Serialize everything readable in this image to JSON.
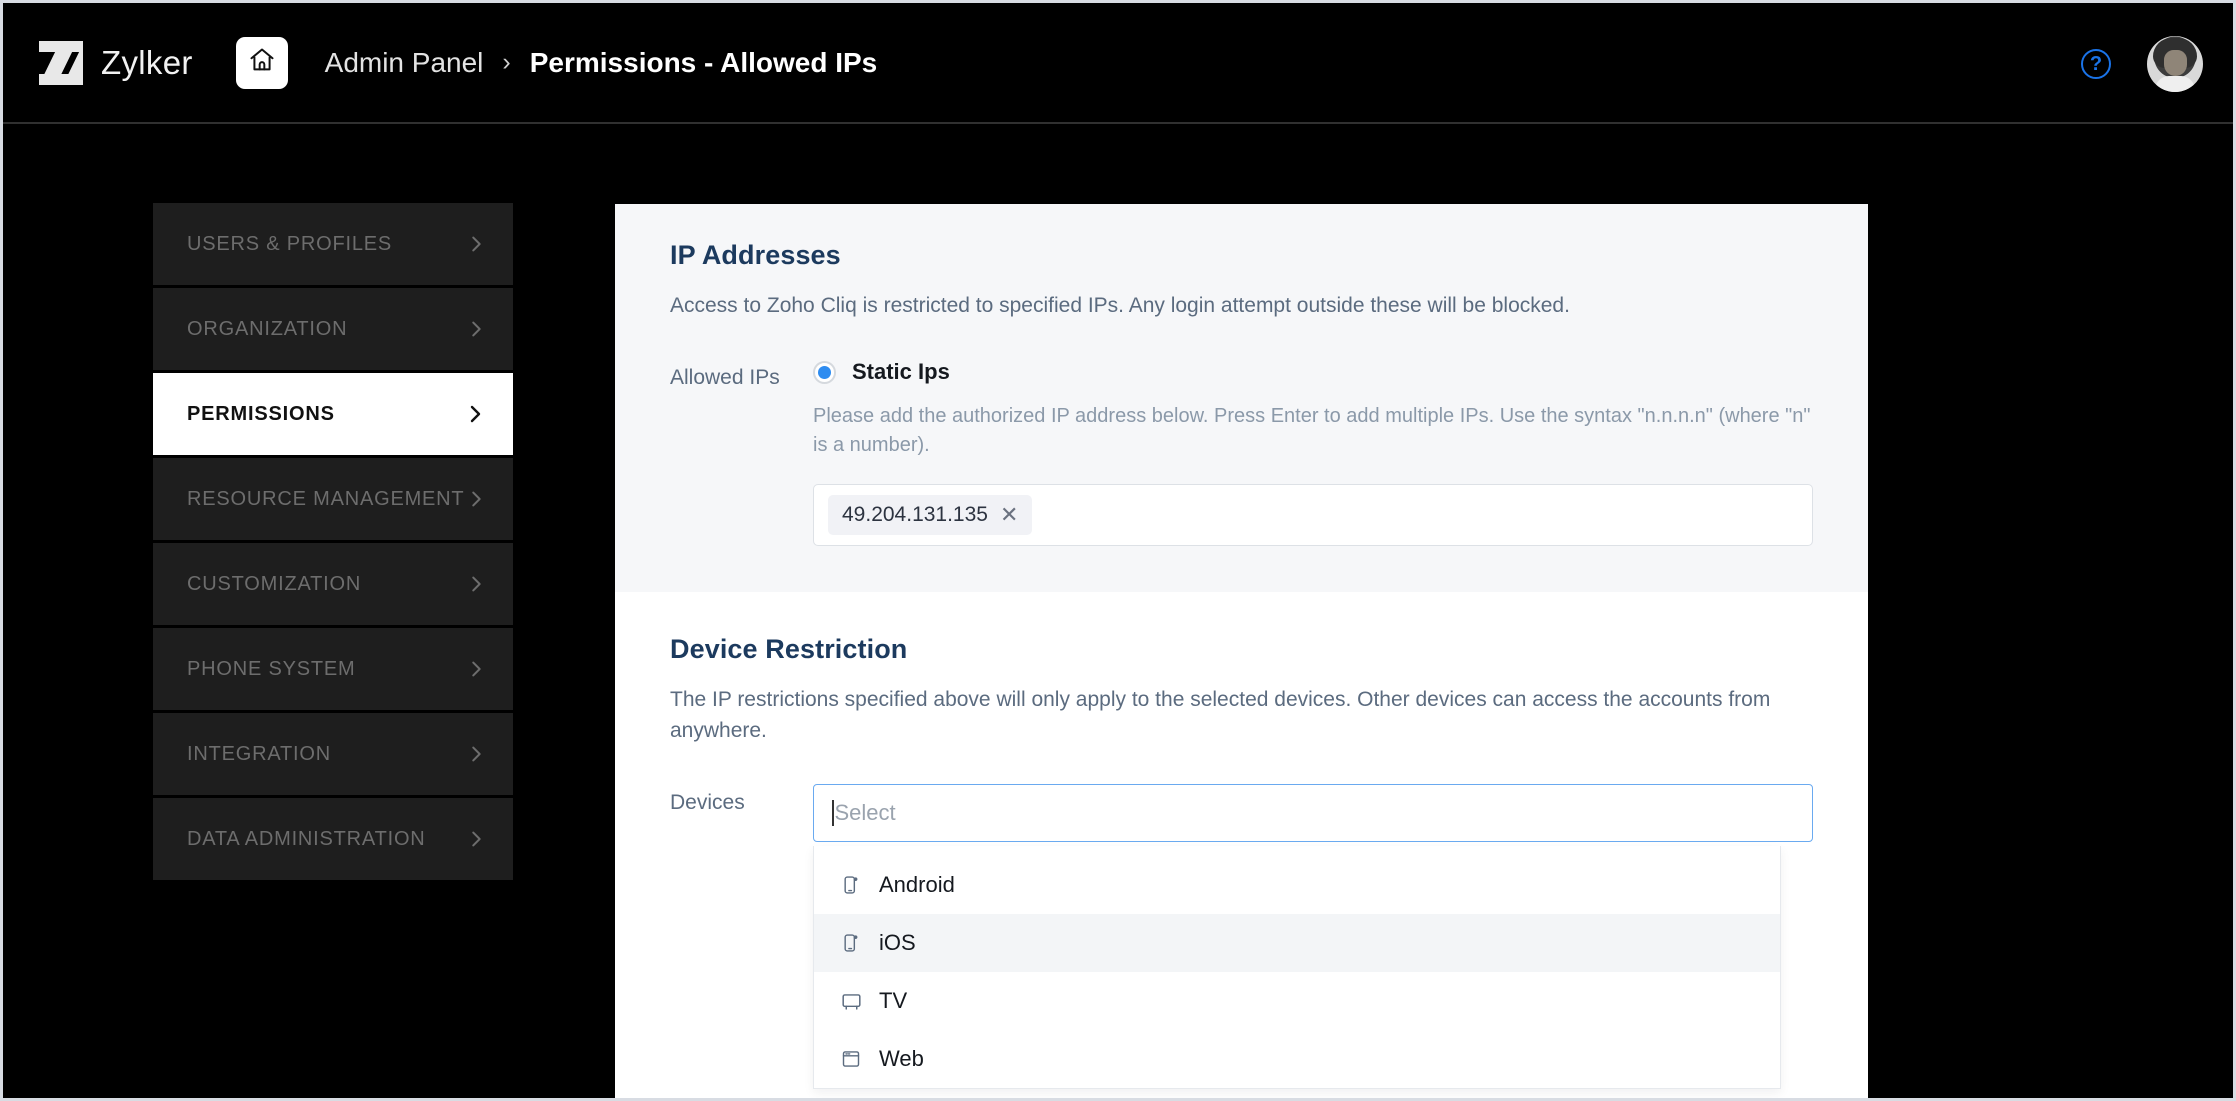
{
  "topbar": {
    "brand_name": "Zylker",
    "logo_icon": "zylker-z-logo",
    "home_icon": "home-icon",
    "breadcrumb": {
      "parent": "Admin Panel",
      "separator": "›",
      "current": "Permissions - Allowed IPs"
    },
    "help_icon": "help-question-icon",
    "help_glyph": "?",
    "avatar_icon": "user-avatar"
  },
  "sidebar": {
    "items": [
      {
        "label": "USERS & PROFILES",
        "active": false,
        "chevron_icon": "chevron-right-icon"
      },
      {
        "label": "ORGANIZATION",
        "active": false,
        "chevron_icon": "chevron-right-icon"
      },
      {
        "label": "PERMISSIONS",
        "active": true,
        "chevron_icon": "chevron-right-icon"
      },
      {
        "label": "RESOURCE MANAGEMENT",
        "active": false,
        "chevron_icon": "chevron-right-icon"
      },
      {
        "label": "CUSTOMIZATION",
        "active": false,
        "chevron_icon": "chevron-right-icon"
      },
      {
        "label": "PHONE SYSTEM",
        "active": false,
        "chevron_icon": "chevron-right-icon"
      },
      {
        "label": "INTEGRATION",
        "active": false,
        "chevron_icon": "chevron-right-icon"
      },
      {
        "label": "DATA ADMINISTRATION",
        "active": false,
        "chevron_icon": "chevron-right-icon"
      }
    ]
  },
  "ip_section": {
    "title": "IP Addresses",
    "description": "Access to Zoho Cliq is restricted to specified IPs. Any login attempt outside these will be blocked.",
    "field_label": "Allowed IPs",
    "radio_label": "Static Ips",
    "radio_selected": true,
    "hint": "Please add the authorized IP address below. Press Enter to add multiple IPs. Use the syntax \"n.n.n.n\" (where \"n\" is a number).",
    "tags": [
      {
        "value": "49.204.131.135",
        "remove_icon": "close-icon",
        "remove_glyph": "✕"
      }
    ]
  },
  "device_section": {
    "title": "Device Restriction",
    "description": "The IP restrictions specified above will only apply to the selected devices. Other devices can access the accounts from anywhere.",
    "field_label": "Devices",
    "select_placeholder": "Select",
    "select_value": "",
    "options": [
      {
        "label": "Android",
        "icon": "mobile-phone-icon",
        "hover": false
      },
      {
        "label": "iOS",
        "icon": "mobile-phone-icon",
        "hover": true
      },
      {
        "label": "TV",
        "icon": "tv-monitor-icon",
        "hover": false
      },
      {
        "label": "Web",
        "icon": "browser-window-icon",
        "hover": false
      }
    ]
  },
  "colors": {
    "accent_blue": "#2e8cf0",
    "help_blue": "#1a73e8",
    "heading_navy": "#1c3a5e",
    "muted_slate": "#5b6b7f",
    "panel_gray": "#f6f7f9",
    "chrome_black": "#000000"
  }
}
